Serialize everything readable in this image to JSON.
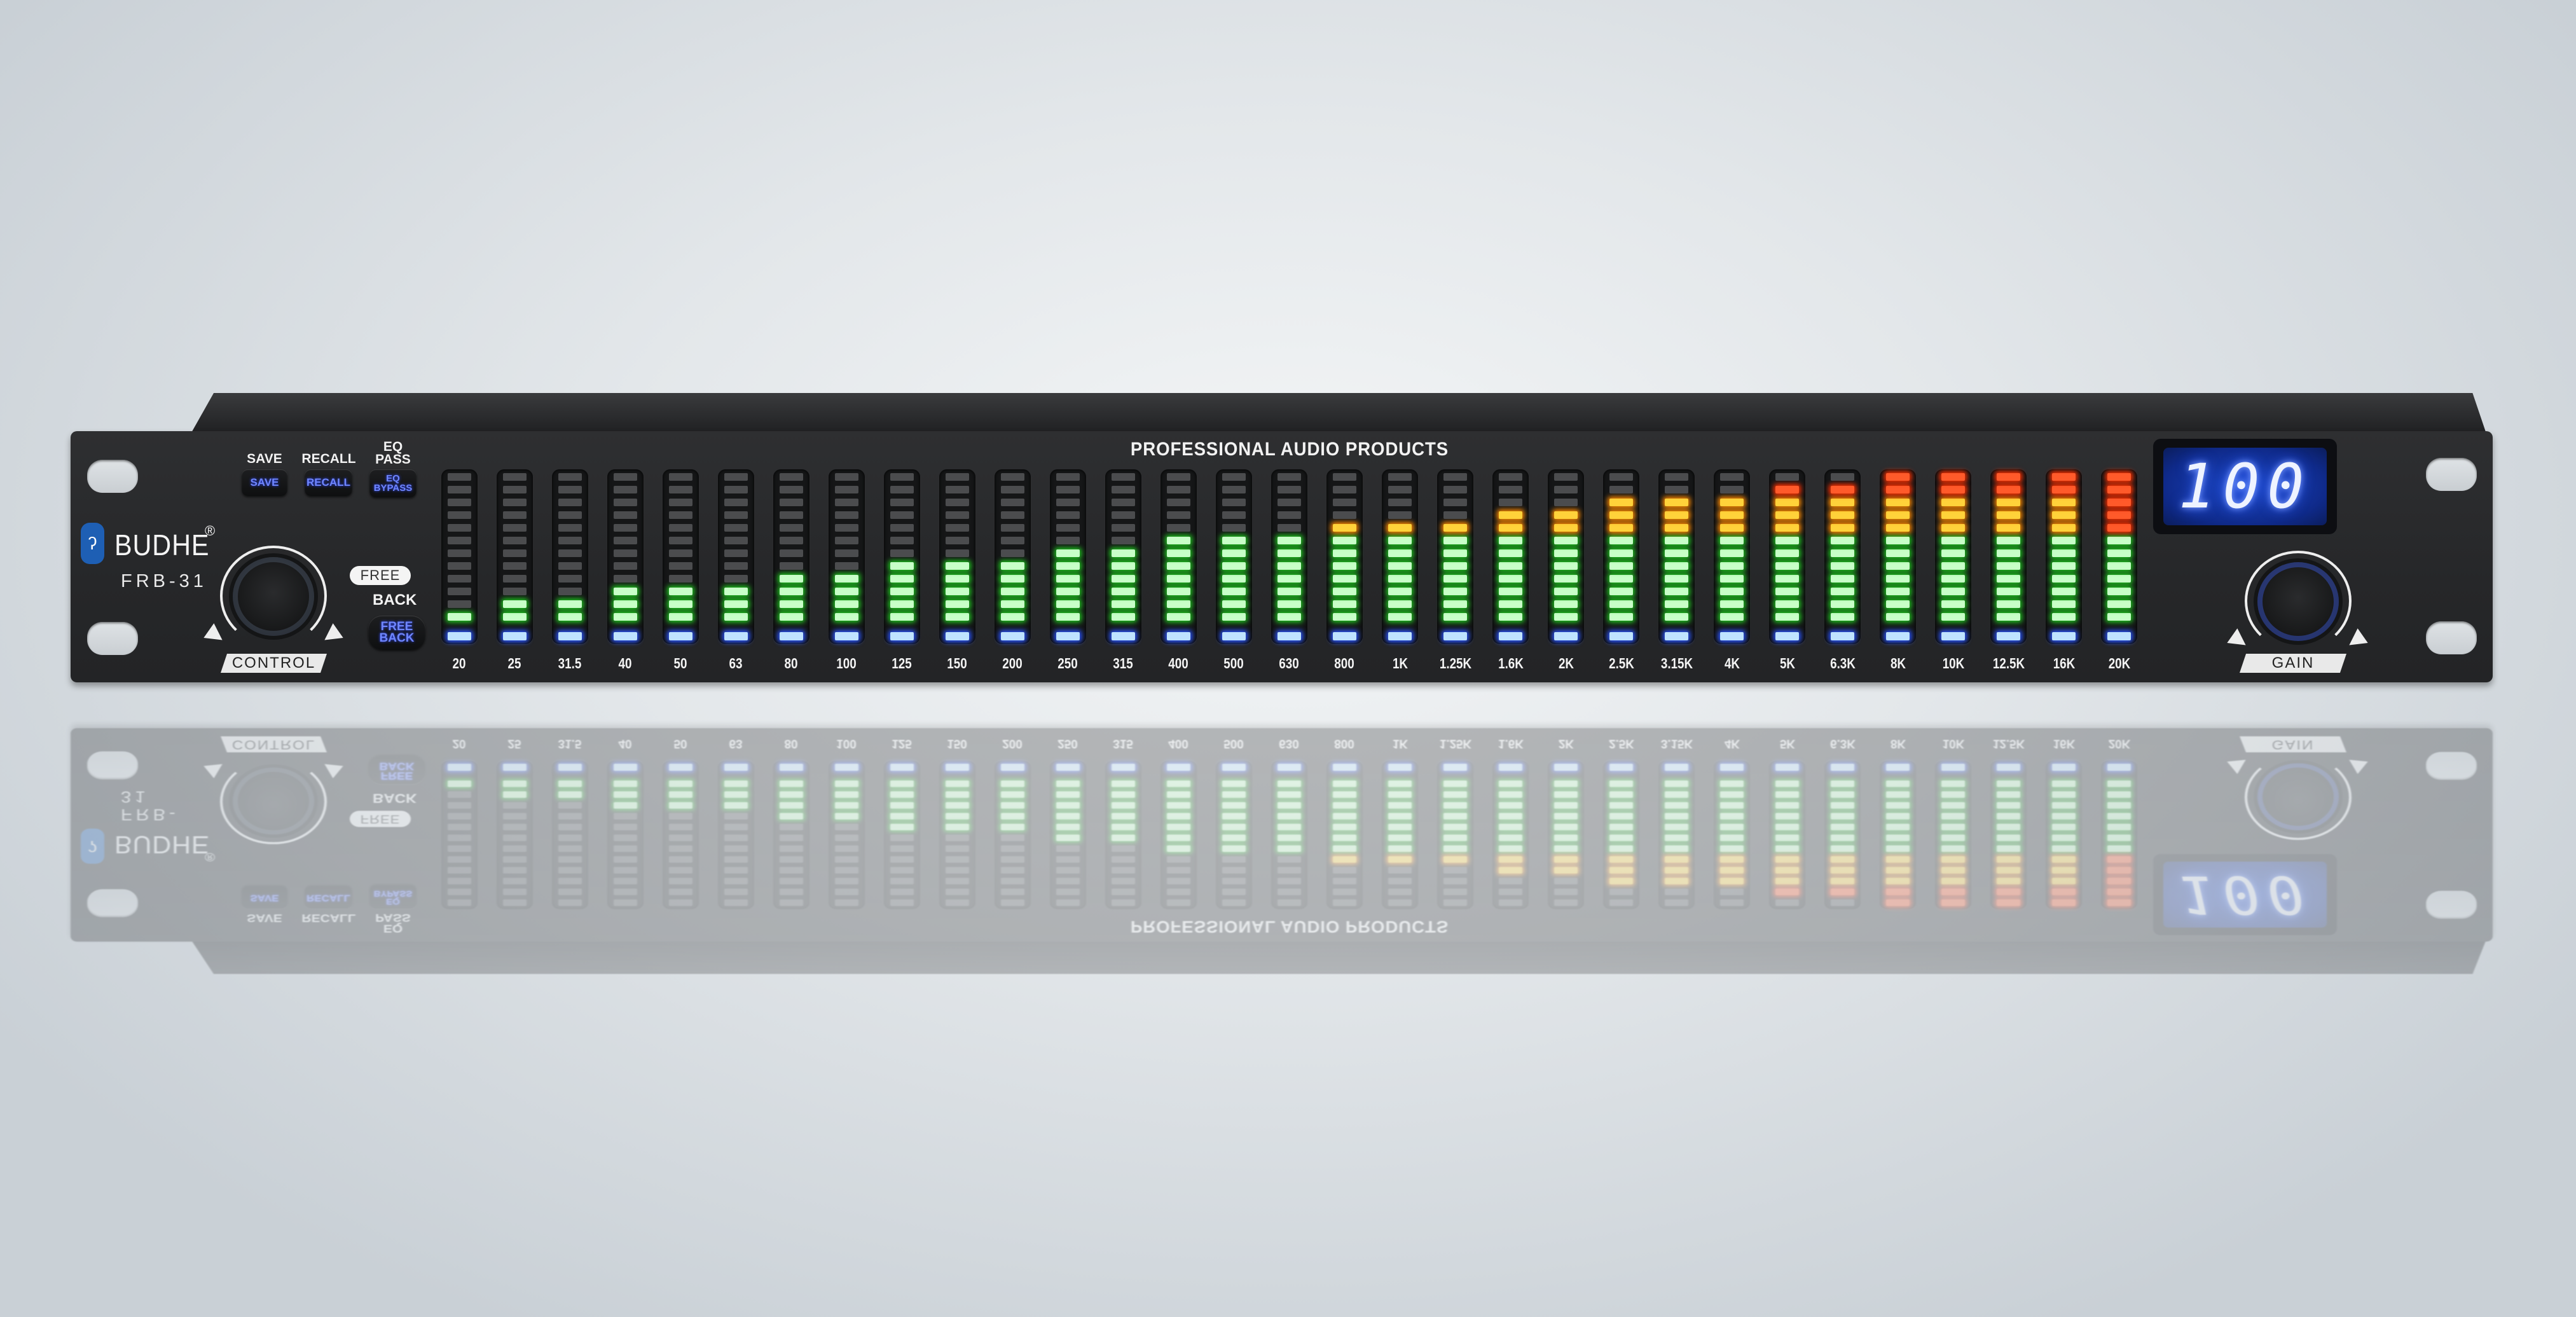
{
  "brand": {
    "name": "BUDHE",
    "registered": "®",
    "model": "FRB-31",
    "logo_icon": "ear-icon"
  },
  "header": "PROFESSIONAL AUDIO PRODUCTS",
  "buttons": {
    "save": {
      "label": "SAVE",
      "key": "SAVE"
    },
    "recall": {
      "label": "RECALL",
      "key": "RECALL"
    },
    "eq_pass": {
      "label_line1": "EQ",
      "label_line2": "PASS",
      "key_line1": "EQ",
      "key_line2": "BYPASS"
    },
    "feedback": {
      "pill": "FREE",
      "label": "BACK",
      "key_line1": "FREE",
      "key_line2": "BACK"
    }
  },
  "knobs": {
    "control": "CONTROL",
    "gain": "GAIN"
  },
  "display_value": "100",
  "meters": {
    "segments": 12,
    "bands": [
      {
        "label": "20",
        "level": 1
      },
      {
        "label": "25",
        "level": 2
      },
      {
        "label": "31.5",
        "level": 2
      },
      {
        "label": "40",
        "level": 3
      },
      {
        "label": "50",
        "level": 3
      },
      {
        "label": "63",
        "level": 3
      },
      {
        "label": "80",
        "level": 4
      },
      {
        "label": "100",
        "level": 4
      },
      {
        "label": "125",
        "level": 5
      },
      {
        "label": "150",
        "level": 5
      },
      {
        "label": "200",
        "level": 5
      },
      {
        "label": "250",
        "level": 6
      },
      {
        "label": "315",
        "level": 6
      },
      {
        "label": "400",
        "level": 7
      },
      {
        "label": "500",
        "level": 7
      },
      {
        "label": "630",
        "level": 7
      },
      {
        "label": "800",
        "level": 8
      },
      {
        "label": "1K",
        "level": 8
      },
      {
        "label": "1.25K",
        "level": 8
      },
      {
        "label": "1.6K",
        "level": 9
      },
      {
        "label": "2K",
        "level": 9
      },
      {
        "label": "2.5K",
        "level": 10
      },
      {
        "label": "3.15K",
        "level": 10
      },
      {
        "label": "4K",
        "level": 10
      },
      {
        "label": "5K",
        "level": 11
      },
      {
        "label": "6.3K",
        "level": 11
      },
      {
        "label": "8K",
        "level": 12
      },
      {
        "label": "10K",
        "level": 12
      },
      {
        "label": "12.5K",
        "level": 12
      },
      {
        "label": "16K",
        "level": 12
      },
      {
        "label": "20K",
        "level": 12
      }
    ]
  },
  "colors": {
    "base_led": "#bfe3ff",
    "green_led": "#c8ffc8",
    "yellow_led": "#ffd23a",
    "red_led": "#ff5a2a",
    "unlit": "#4b4c4e",
    "display": "#1c47c8",
    "key_text": "#6f86ff",
    "logo": "#1e5fb4"
  }
}
